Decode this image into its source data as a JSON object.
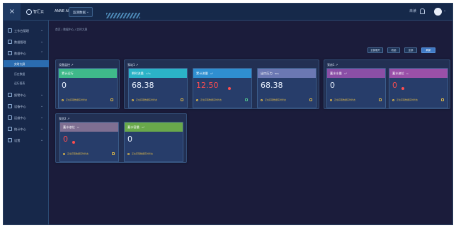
{
  "topbar": {
    "menu_icon": "close-x-icon",
    "brand": "智汇云",
    "system_name": "ANNE ANNE",
    "system_tab": "监测数据",
    "right_text": "未读",
    "avatar_icon": "user-avatar-icon"
  },
  "sidebar": {
    "items": [
      {
        "label": "工作台管理",
        "icon": "dashboard-icon"
      },
      {
        "label": "数据管理",
        "icon": "database-icon"
      },
      {
        "label": "数据中心",
        "icon": "chart-icon"
      }
    ],
    "sub_items": [
      {
        "label": "实时大屏",
        "active": true
      },
      {
        "label": "历史数据",
        "active": false
      },
      {
        "label": "运行报表",
        "active": false
      }
    ],
    "items_lower": [
      {
        "label": "报警中心",
        "icon": "alarm-icon"
      },
      {
        "label": "设备中心",
        "icon": "device-icon"
      },
      {
        "label": "运维中心",
        "icon": "tools-icon"
      },
      {
        "label": "统计中心",
        "icon": "stats-icon"
      },
      {
        "label": "设置",
        "icon": "settings-icon"
      }
    ]
  },
  "breadcrumb": "首页 / 数据中心 / 实时大屏",
  "toolbar": {
    "buttons": [
      "全部展开",
      "收起",
      "全部",
      "刷新"
    ]
  },
  "groups": [
    {
      "title": "设备监控 ↗",
      "cards": [
        {
          "label": "累计运行",
          "unit": "",
          "value": "0",
          "value_red": false,
          "status": "正在获取数据实时状态",
          "head_color": "#3fb98a"
        }
      ]
    },
    {
      "title": "泵站1 ↗",
      "cards": [
        {
          "label": "瞬时流量",
          "unit": "m³/h",
          "value": "68.38",
          "value_red": false,
          "status": "正在获取数据实时状态",
          "head_color": "#2bb3c7"
        },
        {
          "label": "累计流量",
          "unit": "m³",
          "value": "12.50",
          "value_red": true,
          "status": "正在获取数据实时状态",
          "head_color": "#2f8fd1"
        },
        {
          "label": "出口压力",
          "unit": "MPa",
          "value": "68.38",
          "value_red": false,
          "status": "正在获取数据实时状态",
          "head_color": "#6b78b3"
        }
      ]
    },
    {
      "title": "泵房1 ↗",
      "cards": [
        {
          "label": "蓄水水量",
          "unit": "m³",
          "value": "0",
          "value_red": false,
          "status": "正在获取数据实时状态",
          "head_color": "#8a4fa6"
        },
        {
          "label": "蓄水液位",
          "unit": "m",
          "value": "0",
          "value_red": true,
          "status": "正在获取数据实时状态",
          "head_color": "#9a50a8"
        }
      ]
    },
    {
      "title": "泵房2 ↗",
      "cards": [
        {
          "label": "蓄水液位",
          "unit": "m",
          "value": "0",
          "value_red": true,
          "status": "正在获取数据实时状态",
          "head_color": "#7f6f92"
        },
        {
          "label": "蓄水容量",
          "unit": "m³",
          "value": "0",
          "value_red": false,
          "status": "正在获取数据实时状态",
          "head_color": "#69a84b"
        }
      ]
    }
  ],
  "colors": {
    "background": "#1b1c3b",
    "panel": "#223053",
    "card": "#273d6a",
    "accent": "#3f79c4",
    "alert": "#ff4d4f",
    "status": "#d8b44a"
  }
}
